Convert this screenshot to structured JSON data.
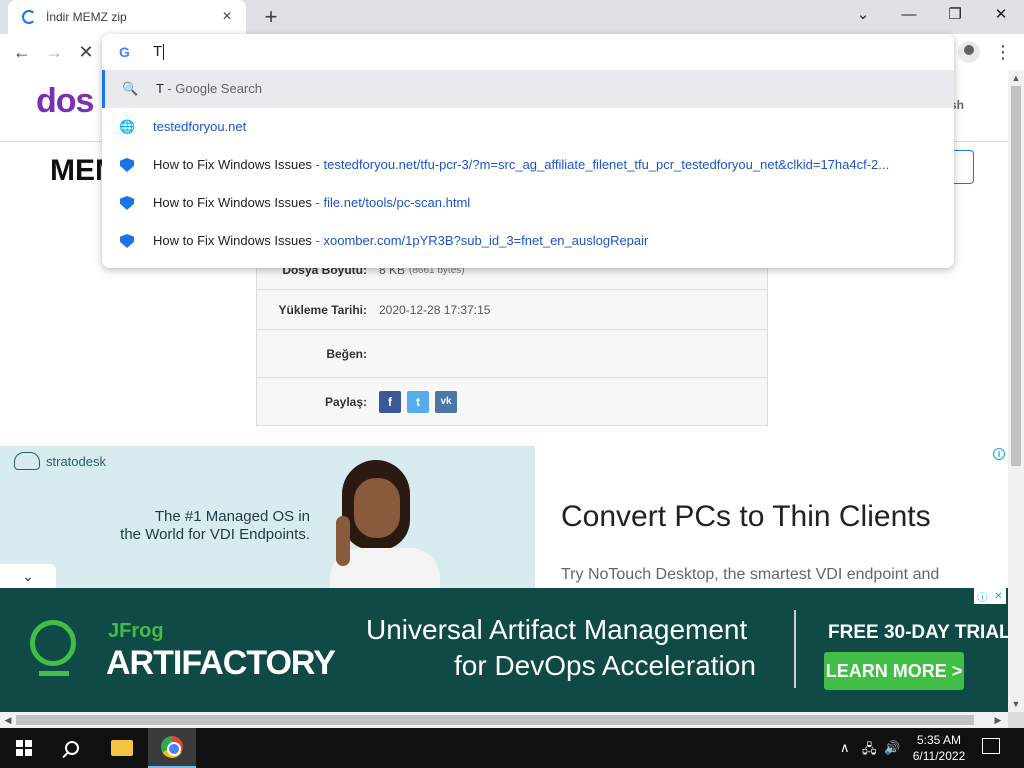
{
  "browser": {
    "tab_title": "İndir MEMZ zip",
    "tab_close": "×",
    "new_tab": "+",
    "window_controls": {
      "collapse_tabs": "⌄",
      "minimize": "—",
      "maximize": "❐",
      "close": "✕"
    },
    "nav": {
      "back": "←",
      "forward": "→",
      "stop": "✕"
    },
    "menu": "⋮"
  },
  "omnibox": {
    "typed_text": "T",
    "google_icon": "G",
    "suggestions": [
      {
        "icon": "search-icon",
        "glyph": "🔍",
        "main": "T",
        "suffix": " - Google Search",
        "url": "",
        "selected": true
      },
      {
        "icon": "globe-icon",
        "glyph": "🌐",
        "main": "",
        "suffix": "",
        "url": "testedforyou.net",
        "selected": false
      },
      {
        "icon": "site-favicon",
        "glyph": "",
        "main": "How to Fix Windows Issues",
        "suffix": " - ",
        "url": "testedforyou.net/tfu-pcr-3/?m=src_ag_affiliate_filenet_tfu_pcr_testedforyou_net&clkid=17ha4cf-2...",
        "selected": false
      },
      {
        "icon": "site-favicon",
        "glyph": "",
        "main": "How to Fix Windows Issues",
        "suffix": " - ",
        "url": "file.net/tools/pc-scan.html",
        "selected": false
      },
      {
        "icon": "site-favicon",
        "glyph": "",
        "main": "How to Fix Windows Issues",
        "suffix": " - ",
        "url": "xoomber.com/1pYR3B?sub_id_3=fnet_en_auslogRepair",
        "selected": false
      }
    ]
  },
  "site": {
    "logo": "dos",
    "header_right": "sh",
    "heading": "MEM",
    "download_partial": "ı",
    "info": [
      {
        "label": "Dosya Boyutu:",
        "value": "8 KB",
        "extra": "(8661 bytes)"
      },
      {
        "label": "Yükleme Tarihi:",
        "value": "2020-12-28 17:37:15",
        "extra": ""
      },
      {
        "label": "Beğen:",
        "value": "",
        "extra": ""
      },
      {
        "label": "Paylaş:",
        "value": "",
        "extra": ""
      }
    ],
    "share": {
      "facebook": "f",
      "twitter": "t",
      "vk": "vk"
    }
  },
  "ad1": {
    "brand": "stratodesk",
    "copy_line1": "The #1 Managed OS in",
    "copy_line2": "the World for VDI Endpoints.",
    "title": "Convert PCs to Thin Clients",
    "subtitle": "Try NoTouch Desktop, the smartest VDI endpoint and",
    "adchoice": "i",
    "collapse": "⌄"
  },
  "ad2": {
    "brand": "JFrog",
    "product": "ARTIFACTORY",
    "line1": "Universal Artifact Management",
    "line2": "for DevOps Acceleration",
    "trial": "FREE 30-DAY TRIAL",
    "cta": "LEARN MORE >",
    "controls": {
      "info": "ⓘ",
      "close": "✕"
    }
  },
  "taskbar": {
    "tray_up": "∧",
    "network": "🖧",
    "volume": "🔊",
    "time": "5:35 AM",
    "date": "6/11/2022"
  },
  "colors": {
    "accent": "#1a73e8",
    "jfrog_green": "#40be46",
    "jfrog_bg": "#0f4a46",
    "logo_purple": "#7b2fb5"
  }
}
